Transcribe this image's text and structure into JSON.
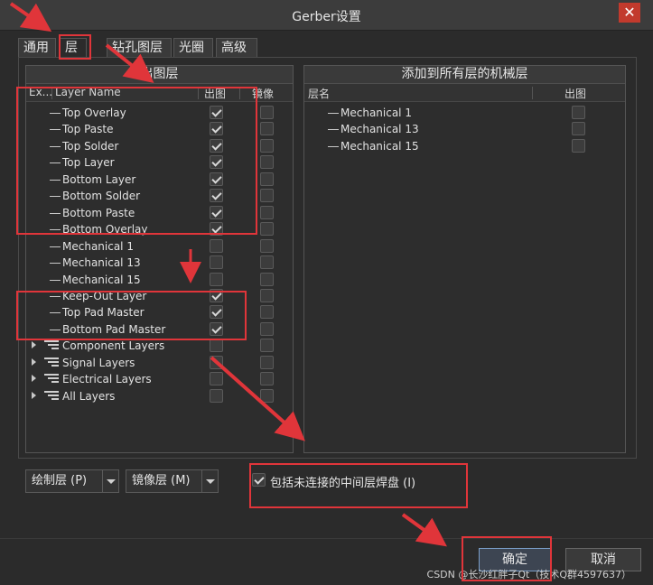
{
  "window": {
    "title": "Gerber设置"
  },
  "tabs": [
    {
      "label": "通用"
    },
    {
      "label": "层"
    },
    {
      "label": "钻孔图层"
    },
    {
      "label": "光圈"
    },
    {
      "label": "高级"
    }
  ],
  "left_panel": {
    "header": "出图层",
    "columns": {
      "expand": "Ex...",
      "name": "Layer Name",
      "plot": "出图",
      "mirror": "镜像"
    },
    "layers": [
      {
        "name": "Top Overlay",
        "plot": true,
        "mirror": false
      },
      {
        "name": "Top Paste",
        "plot": true,
        "mirror": false
      },
      {
        "name": "Top Solder",
        "plot": true,
        "mirror": false
      },
      {
        "name": "Top Layer",
        "plot": true,
        "mirror": false
      },
      {
        "name": "Bottom Layer",
        "plot": true,
        "mirror": false
      },
      {
        "name": "Bottom Solder",
        "plot": true,
        "mirror": false
      },
      {
        "name": "Bottom Paste",
        "plot": true,
        "mirror": false
      },
      {
        "name": "Bottom Overlay",
        "plot": true,
        "mirror": false
      },
      {
        "name": "Mechanical 1",
        "plot": false,
        "mirror": false
      },
      {
        "name": "Mechanical 13",
        "plot": false,
        "mirror": false
      },
      {
        "name": "Mechanical 15",
        "plot": false,
        "mirror": false
      },
      {
        "name": "Keep-Out Layer",
        "plot": true,
        "mirror": false
      },
      {
        "name": "Top Pad Master",
        "plot": true,
        "mirror": false
      },
      {
        "name": "Bottom Pad Master",
        "plot": true,
        "mirror": false
      }
    ],
    "groups": [
      {
        "name": "Component Layers",
        "plot": false,
        "mirror": false
      },
      {
        "name": "Signal Layers",
        "plot": false,
        "mirror": false
      },
      {
        "name": "Electrical Layers",
        "plot": false,
        "mirror": false
      },
      {
        "name": "All Layers",
        "plot": false,
        "mirror": false
      }
    ]
  },
  "right_panel": {
    "header": "添加到所有层的机械层",
    "columns": {
      "name": "层名",
      "plot": "出图"
    },
    "layers": [
      {
        "name": "Mechanical 1",
        "plot": false
      },
      {
        "name": "Mechanical 13",
        "plot": false
      },
      {
        "name": "Mechanical 15",
        "plot": false
      }
    ]
  },
  "controls": {
    "plot_layers_button": "绘制层 (P)",
    "mirror_layers_button": "镜像层 (M)",
    "include_unconnected_pads": {
      "label": "包括未连接的中间层焊盘 (I)",
      "checked": true
    }
  },
  "footer": {
    "ok": "确定",
    "cancel": "取消"
  },
  "watermark": "CSDN @长沙红胖子Qt（技术Q群4597637）"
}
